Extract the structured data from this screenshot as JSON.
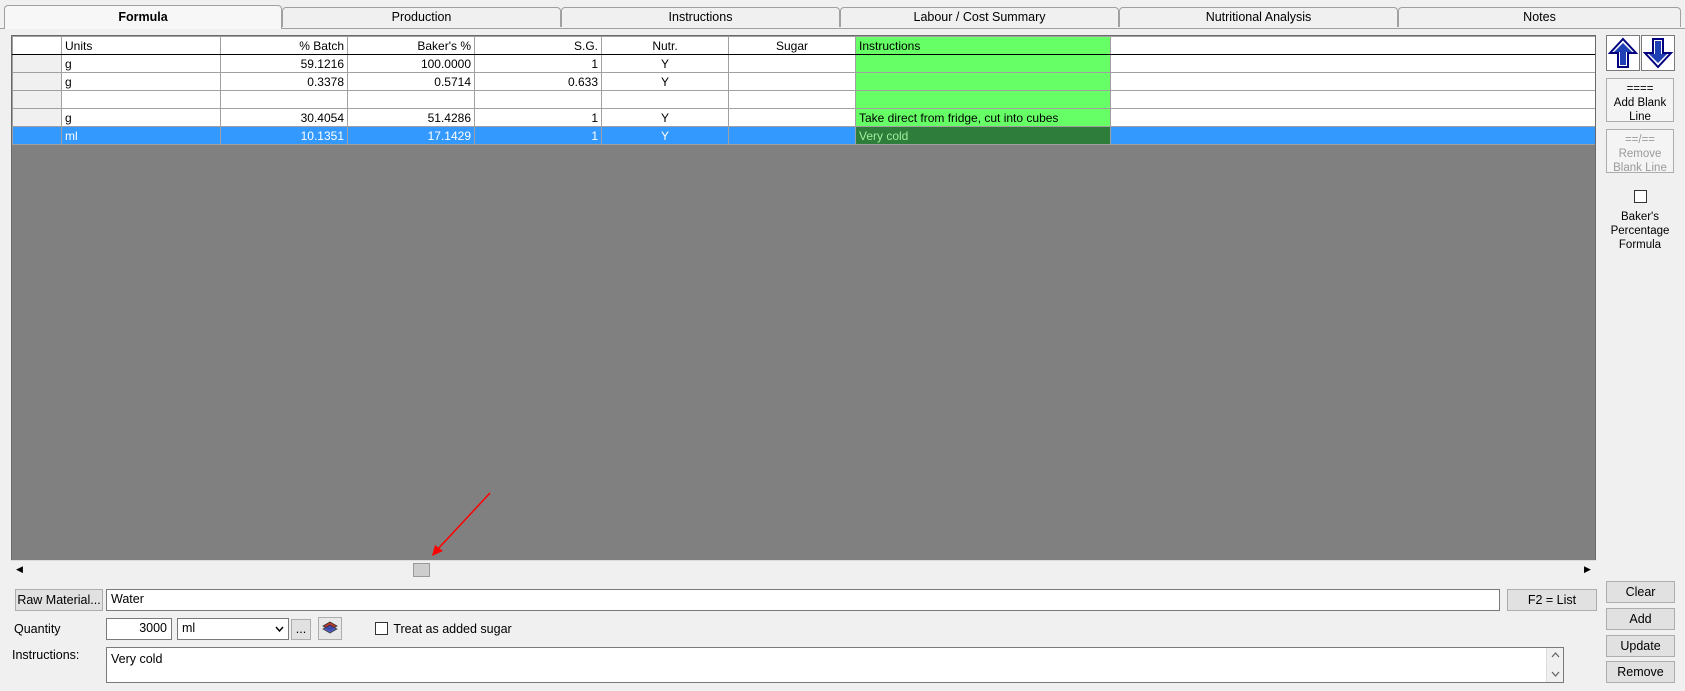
{
  "tabs": [
    "Formula",
    "Production",
    "Instructions",
    "Labour / Cost Summary",
    "Nutritional Analysis",
    "Notes"
  ],
  "grid": {
    "headers": {
      "units": "Units",
      "batch": "% Batch",
      "bakers": "Baker's %",
      "sg": "S.G.",
      "nutr": "Nutr.",
      "sugar": "Sugar",
      "instructions": "Instructions"
    },
    "rows": [
      {
        "units": "g",
        "batch": "59.1216",
        "bakers": "100.0000",
        "sg": "1",
        "nutr": "Y",
        "sugar": "",
        "instructions": ""
      },
      {
        "units": "g",
        "batch": "0.3378",
        "bakers": "0.5714",
        "sg": "0.633",
        "nutr": "Y",
        "sugar": "",
        "instructions": ""
      },
      {
        "units": "",
        "batch": "",
        "bakers": "",
        "sg": "",
        "nutr": "",
        "sugar": "",
        "instructions": ""
      },
      {
        "units": "g",
        "batch": "30.4054",
        "bakers": "51.4286",
        "sg": "1",
        "nutr": "Y",
        "sugar": "",
        "instructions": "Take direct from fridge, cut into cubes"
      },
      {
        "units": "ml",
        "batch": "10.1351",
        "bakers": "17.1429",
        "sg": "1",
        "nutr": "Y",
        "sugar": "",
        "instructions": "Very cold"
      }
    ],
    "scroll_left_glyph": "◀",
    "scroll_right_glyph": "▶"
  },
  "side": {
    "add_blank_line": {
      "symbol": "====",
      "line1": "Add Blank",
      "line2": "Line"
    },
    "remove_blank_line": {
      "symbol": "==/==",
      "line1": "Remove",
      "line2": "Blank Line"
    },
    "bakers_percentage": {
      "line1": "Baker's",
      "line2": "Percentage",
      "line3": "Formula"
    },
    "clear": "Clear",
    "add": "Add",
    "update": "Update",
    "remove": "Remove"
  },
  "form": {
    "raw_material_button": "Raw Material...",
    "raw_material_value": "Water",
    "f2_list": "F2 = List",
    "quantity_label": "Quantity",
    "quantity_value": "3000",
    "unit_value": "ml",
    "ellipsis": "...",
    "treat_sugar_label": "Treat as added sugar",
    "instructions_label": "Instructions:",
    "instructions_value": "Very cold"
  },
  "colors": {
    "instructions_column": "#66ff66",
    "selected_row": "#3399ff",
    "grid_background": "#808080",
    "annotation_arrow": "#ff0000"
  }
}
